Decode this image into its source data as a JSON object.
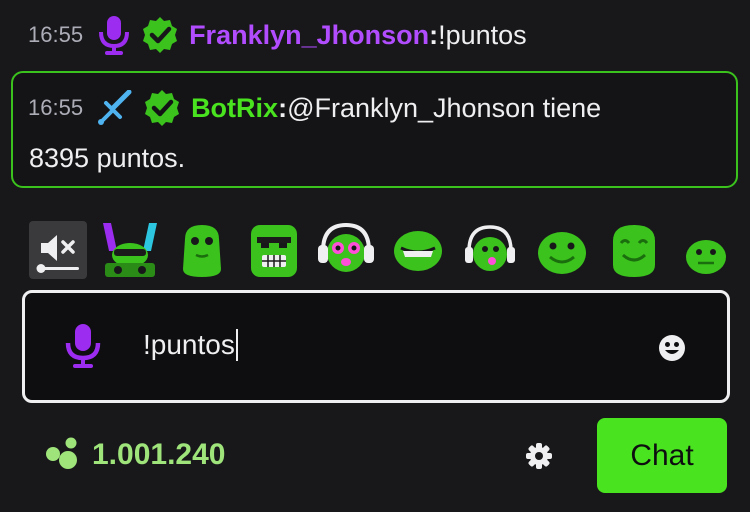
{
  "messages": [
    {
      "time": "16:55",
      "user": "Franklyn_Jhonson",
      "colon": ":",
      "text": " !puntos",
      "badges": [
        "microphone-icon",
        "verified-icon"
      ],
      "user_color": "#b14dff"
    },
    {
      "time": "16:55",
      "user": "BotRix",
      "colon": ":",
      "text_line1": " @Franklyn_Jhonson tiene",
      "text_line2": "8395 puntos.",
      "badges": [
        "sword-icon",
        "verified-icon"
      ],
      "user_color": "#49e31f",
      "highlighted": true
    }
  ],
  "emotes": [
    "mute-toggle-icon",
    "dj-frog-emote",
    "frog-emote",
    "angry-frog-emote",
    "headphones-frog-emote",
    "grin-frog-emote",
    "singing-frog-emote",
    "smile-frog-emote",
    "happy-frog-emote",
    "small-frog-emote"
  ],
  "input": {
    "value": "!puntos",
    "left_icon": "microphone-icon",
    "right_icon": "emoji-icon"
  },
  "footer": {
    "points": "1.001.240",
    "points_icon": "channel-points-icon",
    "settings_icon": "gear-icon",
    "chat_button": "Chat"
  },
  "colors": {
    "background": "#18181b",
    "accent_green": "#49e31f",
    "purple": "#b14dff",
    "points_green": "#9ee47a"
  }
}
